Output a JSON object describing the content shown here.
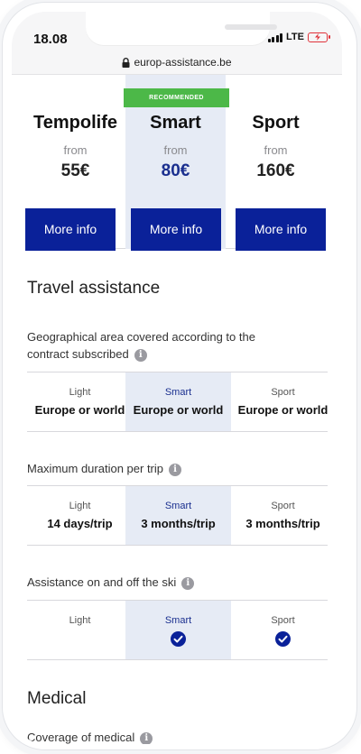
{
  "status": {
    "time": "18.08",
    "network": "LTE"
  },
  "browser": {
    "url": "europ-assistance.be"
  },
  "plans": [
    {
      "name": "Tempolife",
      "from": "from",
      "price": "55€",
      "button": "More info"
    },
    {
      "name": "Smart",
      "from": "from",
      "price": "80€",
      "button": "More info",
      "badge": "RECOMMENDED"
    },
    {
      "name": "Sport",
      "from": "from",
      "price": "160€",
      "button": "More info"
    }
  ],
  "travel_section": {
    "title": "Travel assistance",
    "questions": [
      {
        "text": "Geographical area covered according to the contract subscribed",
        "cells": [
          {
            "label": "Light",
            "value": "Europe or world"
          },
          {
            "label": "Smart",
            "value": "Europe or world"
          },
          {
            "label": "Sport",
            "value": "Europe or world"
          }
        ]
      },
      {
        "text": "Maximum duration per trip",
        "cells": [
          {
            "label": "Light",
            "value": "14 days/trip"
          },
          {
            "label": "Smart",
            "value": "3 months/trip"
          },
          {
            "label": "Sport",
            "value": "3 months/trip"
          }
        ]
      },
      {
        "text": "Assistance on and off the ski",
        "cells": [
          {
            "label": "Light",
            "value": "",
            "check": false
          },
          {
            "label": "Smart",
            "value": "",
            "check": true
          },
          {
            "label": "Sport",
            "value": "",
            "check": true
          }
        ]
      }
    ]
  },
  "medical_section": {
    "title": "Medical",
    "partial_question": "Coverage of medical"
  },
  "colors": {
    "brand_blue": "#0a2199",
    "recommended_green": "#4cb848",
    "highlight": "#e6ebf5"
  }
}
